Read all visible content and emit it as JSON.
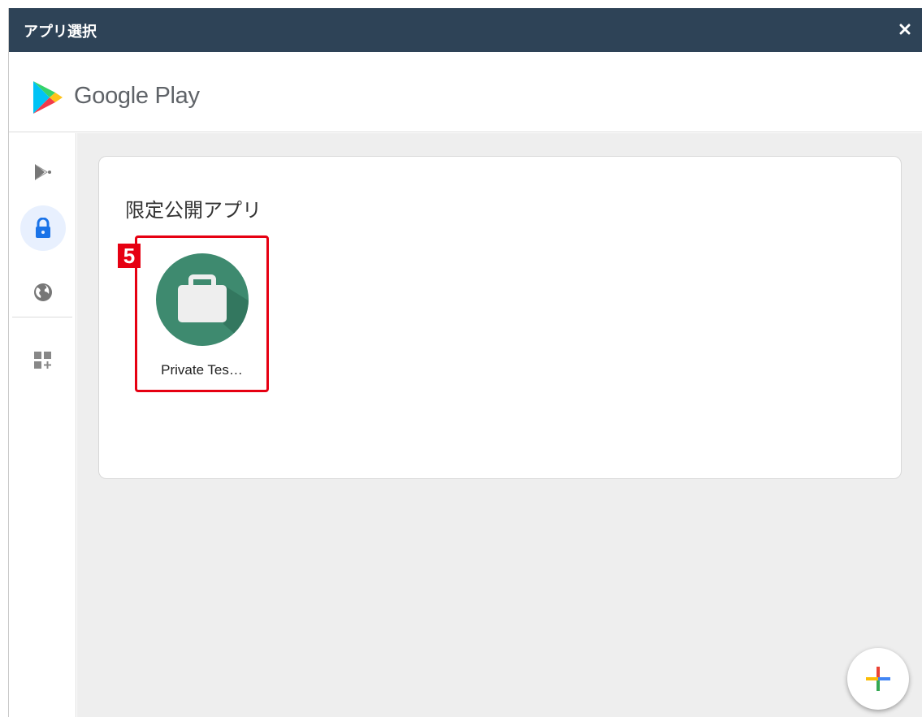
{
  "dialog": {
    "title": "アプリ選択",
    "close_icon": "close-icon"
  },
  "header": {
    "brand_text": "Google Play",
    "logo_icon": "google-play-logo"
  },
  "sidebar": {
    "items": [
      {
        "icon": "play-store-icon",
        "active": false
      },
      {
        "icon": "lock-icon",
        "active": true
      },
      {
        "icon": "globe-icon",
        "active": false
      },
      {
        "icon": "add-apps-icon",
        "active": false
      }
    ]
  },
  "main": {
    "section_title": "限定公開アプリ",
    "apps": [
      {
        "name": "Private Tes…",
        "icon": "briefcase-icon",
        "icon_color": "#3e8a6f"
      }
    ]
  },
  "annotation": {
    "badge_number": "5",
    "highlight_color": "#e60012"
  },
  "fab": {
    "icon": "plus-icon"
  },
  "colors": {
    "titlebar": "#2e4357",
    "accent_blue": "#1a73e8",
    "content_bg": "#eeeeee"
  }
}
